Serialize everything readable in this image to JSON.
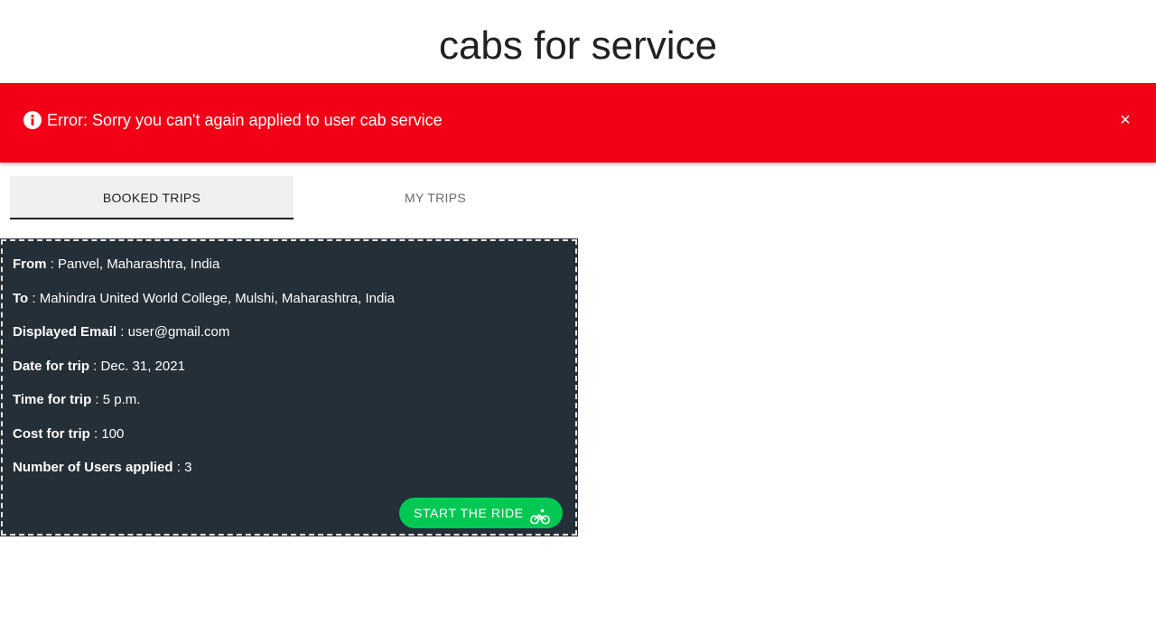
{
  "header": {
    "title": "cabs for service"
  },
  "alert": {
    "icon": "info-icon",
    "message": "Error: Sorry you can't again applied to user cab service",
    "close_label": "×",
    "color": "#f20016"
  },
  "tabs": [
    {
      "label": "BOOKED TRIPS",
      "active": true
    },
    {
      "label": "MY TRIPS",
      "active": false
    }
  ],
  "trip": {
    "from_label": "From",
    "from_value": "Panvel, Maharashtra, India",
    "to_label": "To",
    "to_value": "Mahindra United World College, Mulshi, Maharashtra, India",
    "email_label": "Displayed Email",
    "email_value": "user@gmail.com",
    "date_label": "Date for trip",
    "date_value": "Dec. 31, 2021",
    "time_label": "Time for trip",
    "time_value": "5 p.m.",
    "cost_label": "Cost for trip",
    "cost_value": "100",
    "users_label": "Number of Users applied",
    "users_value": "3",
    "separator": " : ",
    "start_button_label": "START THE RIDE",
    "start_button_icon": "bicycle-icon",
    "card_color": "#242f38",
    "button_color": "#00c853"
  }
}
